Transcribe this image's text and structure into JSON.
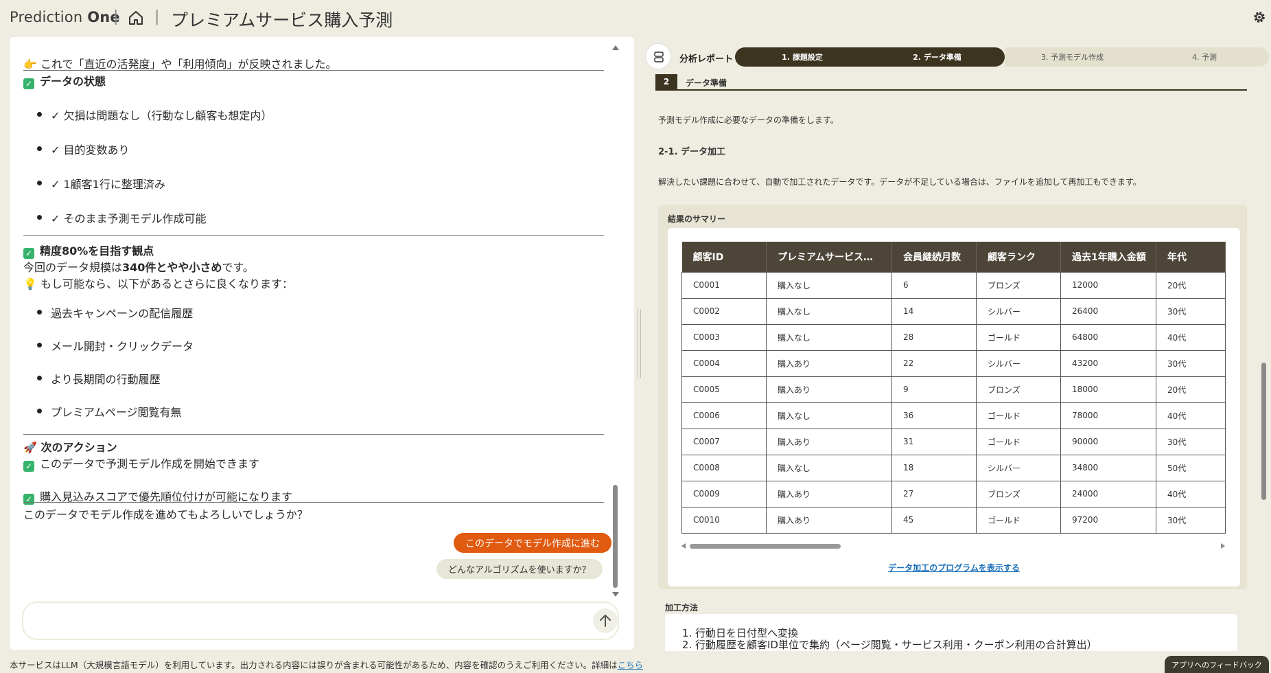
{
  "header": {
    "brand_light": "Prediction",
    "brand_bold": "One",
    "title": "プレミアムサービス購入予測"
  },
  "chat": {
    "intro": "👉 これで「直近の活発度」や「利用傾向」が反映されました。",
    "data_status_heading": "データの状態",
    "data_status_items": [
      "✓ 欠損は問題なし（行動なし顧客も想定内）",
      "✓ 目的変数あり",
      "✓ 1顧客1行に整理済み",
      "✓ そのまま予測モデル作成可能"
    ],
    "accuracy_heading": "精度80%を目指す観点",
    "scale_prefix": "今回のデータ規模は",
    "scale_bold": "340件とやや小さめ",
    "scale_suffix": "です。",
    "hint": "💡 もし可能なら、以下があるとさらに良くなります：",
    "hint_items": [
      "過去キャンペーンの配信履歴",
      "メール開封・クリックデータ",
      "より長期間の行動履歴",
      "プレミアムページ閲覧有無"
    ],
    "next_heading": "🚀 次のアクション",
    "next_item_1": "このデータで予測モデル作成を開始できます",
    "next_item_2": "購入見込みスコアで優先順位付けが可能になります",
    "question": "このデータでモデル作成を進めてもよろしいでしょうか？",
    "primary_button": "このデータでモデル作成に進む",
    "secondary_button": "どんなアルゴリズムを使いますか？",
    "input_placeholder": ""
  },
  "footer": {
    "notice": "本サービスはLLM（大規模言語モデル）を利用しています。出力される内容には誤りが含まれる可能性があるため、内容を確認のうえご利用ください。詳細は",
    "link": "こちら",
    "feedback": "アプリへのフィードバック"
  },
  "report": {
    "label": "分析レポート",
    "steps": [
      {
        "label": "1. 課題設定",
        "state": "active"
      },
      {
        "label": "2. データ準備",
        "state": "active"
      },
      {
        "label": "3. 予測モデル作成",
        "state": "inactive"
      },
      {
        "label": "4. 予測",
        "state": "inactive"
      }
    ],
    "section_num": "2",
    "section_title": "データ準備",
    "intro": "予測モデル作成に必要なデータの準備をします。",
    "sub_heading": "2-1. データ加工",
    "sub_desc": "解決したい課題に合わせて、自動で加工されたデータです。データが不足している場合は、ファイルを追加して再加工もできます。",
    "summary_title": "結果のサマリー",
    "table": {
      "headers": [
        "顧客ID",
        "プレミアムサービス…",
        "会員継続月数",
        "顧客ランク",
        "過去1年購入金額",
        "年代"
      ],
      "rows": [
        [
          "C0001",
          "購入なし",
          "6",
          "ブロンズ",
          "12000",
          "20代"
        ],
        [
          "C0002",
          "購入なし",
          "14",
          "シルバー",
          "26400",
          "30代"
        ],
        [
          "C0003",
          "購入なし",
          "28",
          "ゴールド",
          "64800",
          "40代"
        ],
        [
          "C0004",
          "購入あり",
          "22",
          "シルバー",
          "43200",
          "30代"
        ],
        [
          "C0005",
          "購入あり",
          "9",
          "ブロンズ",
          "18000",
          "20代"
        ],
        [
          "C0006",
          "購入なし",
          "36",
          "ゴールド",
          "78000",
          "40代"
        ],
        [
          "C0007",
          "購入あり",
          "31",
          "ゴールド",
          "90000",
          "30代"
        ],
        [
          "C0008",
          "購入なし",
          "18",
          "シルバー",
          "34800",
          "50代"
        ],
        [
          "C0009",
          "購入あり",
          "27",
          "ブロンズ",
          "24000",
          "40代"
        ],
        [
          "C0010",
          "購入あり",
          "45",
          "ゴールド",
          "97200",
          "30代"
        ]
      ]
    },
    "program_link": "データ加工のプログラムを表示する",
    "method_title": "加工方法",
    "methods": [
      "行動日を日付型へ変換",
      "行動履歴を顧客ID単位で集約（ページ閲覧・サービス利用・クーポン利用の合計算出）"
    ]
  },
  "colors": {
    "accent_orange": "#e05a10",
    "step_active": "#3d3420",
    "table_header": "#4d4538",
    "background": "#efede2"
  }
}
